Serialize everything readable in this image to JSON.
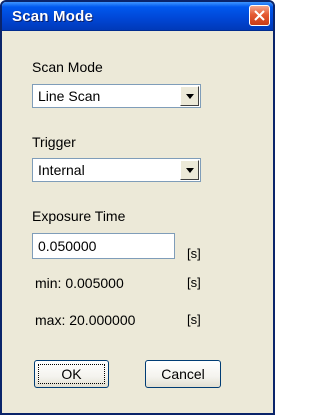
{
  "window": {
    "title": "Scan Mode",
    "close_icon": "close-icon"
  },
  "scan_mode": {
    "label": "Scan Mode",
    "selected": "Line Scan"
  },
  "trigger": {
    "label": "Trigger",
    "selected": "Internal"
  },
  "exposure": {
    "label": "Exposure Time",
    "value": "0.050000",
    "unit": "[s]",
    "min_label": "min: 0.005000",
    "min_unit": "[s]",
    "max_label": "max: 20.000000",
    "max_unit": "[s]"
  },
  "buttons": {
    "ok_label": "OK",
    "cancel_label": "Cancel"
  },
  "colors": {
    "titlebar": "#0046d5",
    "close_button": "#e55a33",
    "dialog_background": "#ece9d8"
  }
}
